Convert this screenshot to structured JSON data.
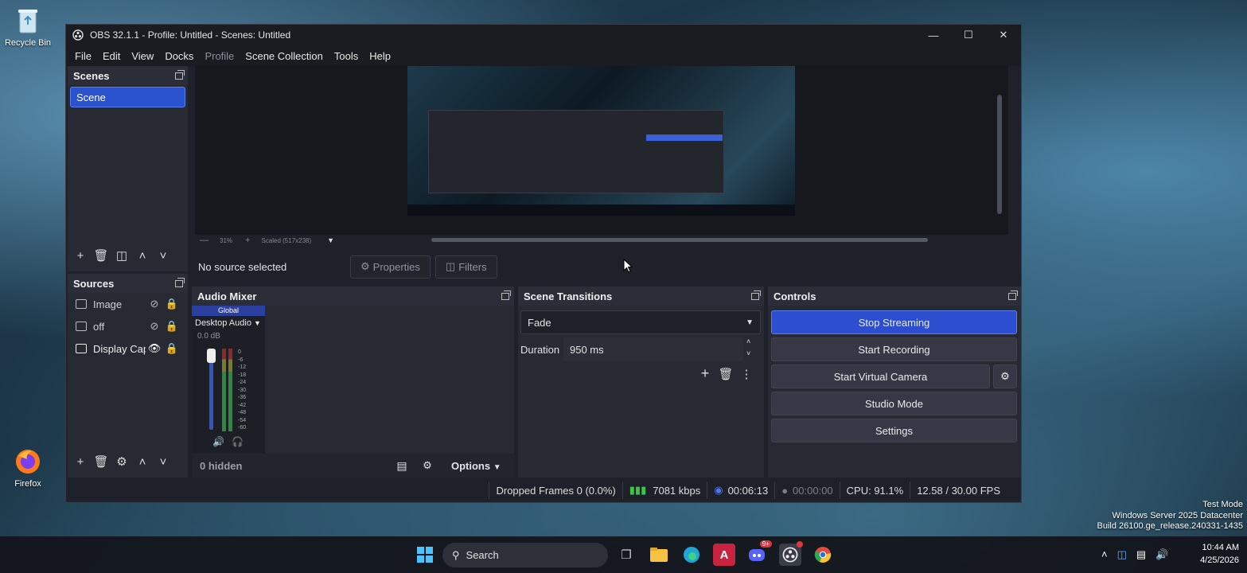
{
  "desktop": {
    "icons": [
      {
        "label": "Recycle Bin",
        "icon": "recycle-bin-icon"
      },
      {
        "label": "Firefox",
        "icon": "firefox-icon"
      }
    ],
    "watermark": [
      "Test Mode",
      "Windows Server 2025 Datacenter",
      "Build 26100.ge_release.240331-1435"
    ]
  },
  "window": {
    "title": "OBS 32.1.1 - Profile: Untitled - Scenes: Untitled",
    "menu": [
      "File",
      "Edit",
      "View",
      "Docks",
      "Profile",
      "Scene Collection",
      "Tools",
      "Help"
    ]
  },
  "preview": {
    "zoom": "31%",
    "scaled": "Scaled (517x238)"
  },
  "scenes": {
    "title": "Scenes",
    "items": [
      "Scene"
    ]
  },
  "sources": {
    "title": "Sources",
    "items": [
      {
        "name": "Image",
        "visible": false,
        "icon": "image-icon"
      },
      {
        "name": "off",
        "visible": false,
        "icon": "image-icon"
      },
      {
        "name": "Display Cap",
        "visible": true,
        "icon": "display-capture-icon"
      }
    ]
  },
  "context": {
    "no_source": "No source selected",
    "properties": "Properties",
    "filters": "Filters"
  },
  "mixer": {
    "title": "Audio Mixer",
    "global": "Global",
    "channel": "Desktop Audio",
    "db": "0.0 dB",
    "scale": [
      "0",
      "-6",
      "-12",
      "-18",
      "-24",
      "-30",
      "-36",
      "-42",
      "-48",
      "-54",
      "-60"
    ],
    "hidden": "0 hidden",
    "options": "Options"
  },
  "transitions": {
    "title": "Scene Transitions",
    "selected": "Fade",
    "duration_label": "Duration",
    "duration_value": "950 ms"
  },
  "controls": {
    "title": "Controls",
    "stop_streaming": "Stop Streaming",
    "start_recording": "Start Recording",
    "start_virtual_camera": "Start Virtual Camera",
    "studio_mode": "Studio Mode",
    "settings": "Settings"
  },
  "status": {
    "dropped": "Dropped Frames 0 (0.0%)",
    "bitrate": "7081 kbps",
    "stream_time": "00:06:13",
    "rec_time": "00:00:00",
    "cpu": "CPU: 91.1%",
    "fps": "12.58 / 30.00 FPS"
  },
  "taskbar": {
    "search": "Search",
    "discord_badge": "9+",
    "time": "10:44 AM",
    "date": "4/25/2026"
  },
  "colors": {
    "accent": "#2d4ed0",
    "panel": "#272a33",
    "window_bg": "#1f212a"
  }
}
